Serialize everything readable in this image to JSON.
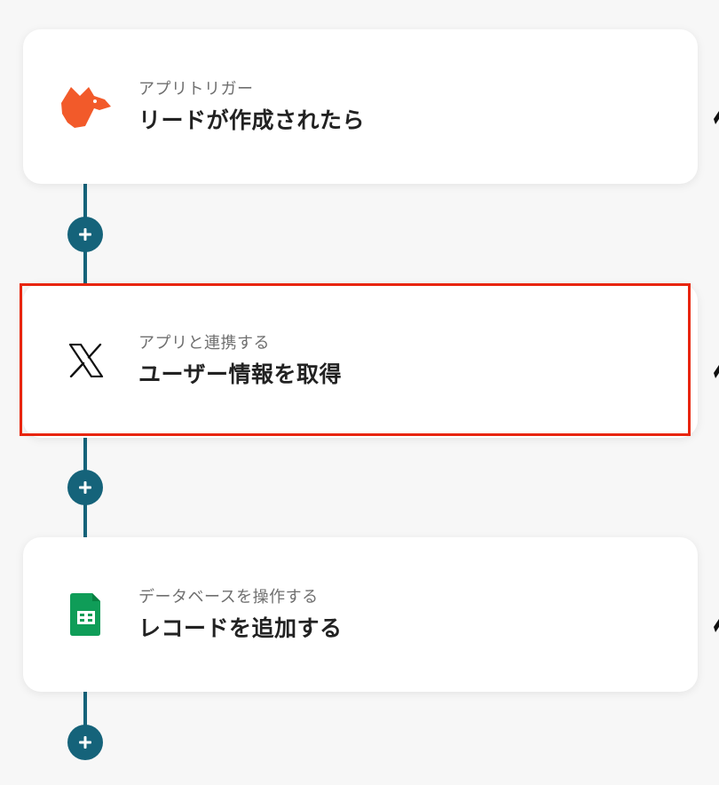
{
  "flow": {
    "steps": [
      {
        "subtitle": "アプリトリガー",
        "title": "リードが作成されたら",
        "icon": "fox-icon"
      },
      {
        "subtitle": "アプリと連携する",
        "title": "ユーザー情報を取得",
        "icon": "x-logo-icon"
      },
      {
        "subtitle": "データベースを操作する",
        "title": "レコードを追加する",
        "icon": "google-sheets-icon"
      }
    ],
    "add_buttons": [
      "plus-icon",
      "plus-icon",
      "plus-icon"
    ]
  },
  "colors": {
    "background": "#f7f7f7",
    "connector": "#15637a",
    "highlight": "#e8250c",
    "fox": "#f25a2a",
    "sheets": "#0f9d58"
  }
}
